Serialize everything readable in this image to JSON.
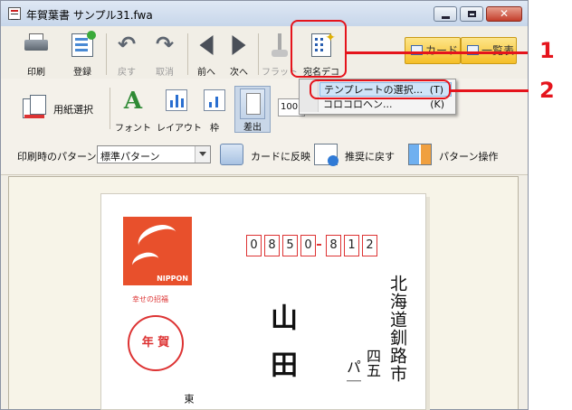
{
  "window": {
    "title": "年賀葉書  サンプル31.fwa",
    "controls": {
      "minimize_icon": "minimize-icon",
      "maximize_icon": "maximize-icon",
      "close_label": "✕"
    }
  },
  "toolbar1": {
    "print": "印刷",
    "register": "登録",
    "undo": "戻す",
    "cancel": "取消",
    "prev": "前へ",
    "next": "次へ",
    "flat": "フラット",
    "atena_deco": "宛名デコ",
    "card_view": "カード",
    "list_view": "一覧表"
  },
  "toolbar2": {
    "paper_select": "用紙選択",
    "font": "フォント",
    "layout": "レイアウト",
    "frame": "枠",
    "sender": "差出",
    "zoom": "100"
  },
  "pattern_bar": {
    "label": "印刷時のパターン",
    "selected": "標準パターン",
    "apply_card": "カードに反映",
    "reset_recommended": "推奨に戻す",
    "pattern_ops": "パターン操作"
  },
  "context_menu": {
    "items": [
      {
        "label": "テンプレートの選択...",
        "key": "(T)",
        "highlighted": true
      },
      {
        "label": "コロコロヘン...",
        "key": "(K)",
        "highlighted": false
      }
    ]
  },
  "postcard": {
    "stamp_brand": "NIPPON",
    "stamp_caption": "幸せの招福",
    "nenga_mark": "年 賀",
    "zip_digits": [
      "0",
      "8",
      "5",
      "0",
      "8",
      "1",
      "2"
    ],
    "address_line1": "北海道釧路市",
    "address_line2": "四五",
    "address_line3": "パ｜",
    "recipient_name": "山田",
    "sender_fragment": "東"
  },
  "annotations": {
    "callout1": "1",
    "callout2": "2"
  },
  "colors": {
    "accent_red": "#e5141c",
    "stamp_orange": "#e8502c",
    "card_button": "#f5bf27"
  }
}
